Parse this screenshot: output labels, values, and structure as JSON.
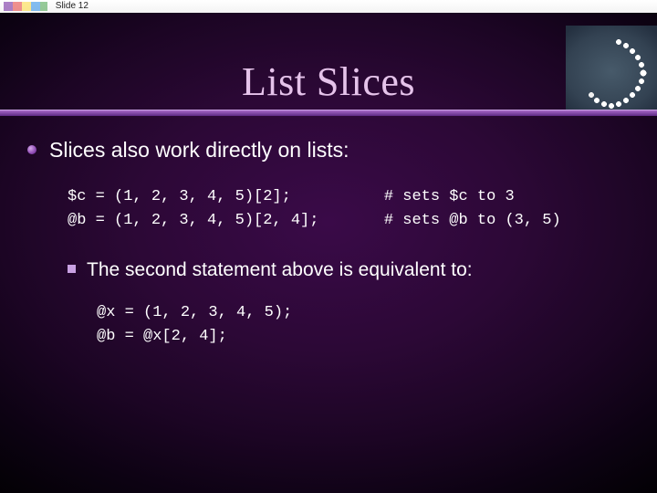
{
  "meta": {
    "slide_label": "Slide 12"
  },
  "title": "List Slices",
  "bullets": {
    "main": "Slices also work directly on lists:",
    "sub": "The second statement above is equivalent to:"
  },
  "code1": "$c = (1, 2, 3, 4, 5)[2];          # sets $c to 3\n@b = (1, 2, 3, 4, 5)[2, 4];       # sets @b to (3, 5)",
  "code2": "@x = (1, 2, 3, 4, 5);\n@b = @x[2, 4];"
}
